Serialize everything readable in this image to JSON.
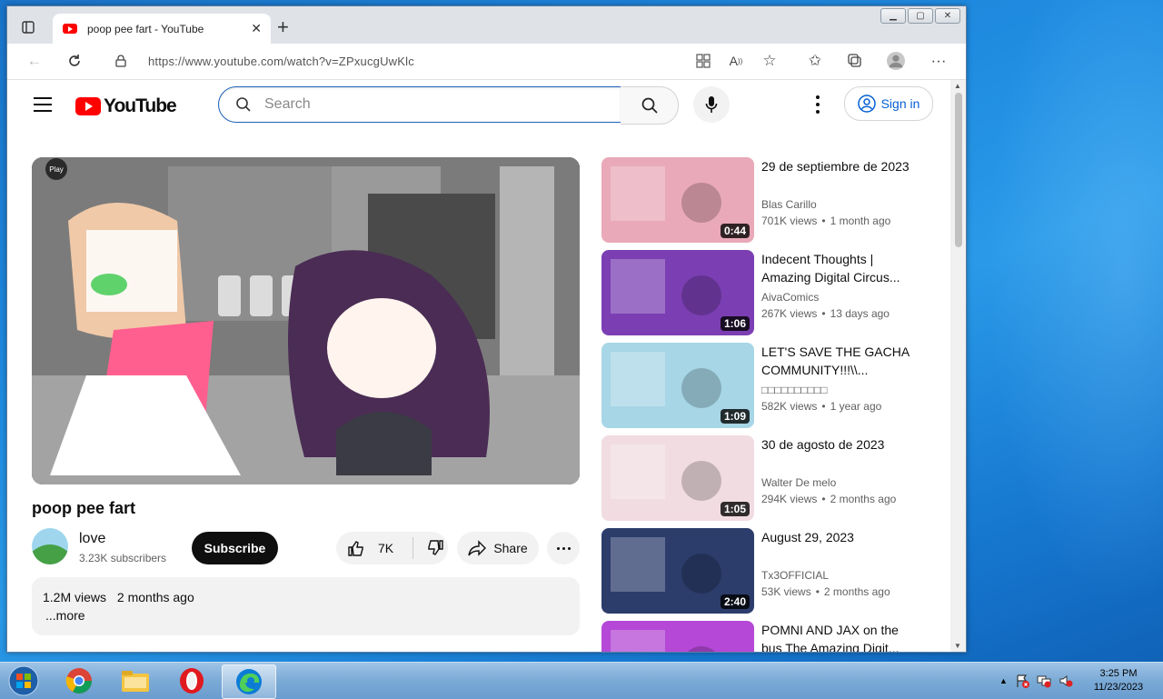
{
  "browser": {
    "tab_title": "poop pee fart - YouTube",
    "url": "https://www.youtube.com/watch?v=ZPxucgUwKlc"
  },
  "youtube": {
    "logo_text": "YouTube",
    "search_placeholder": "Search",
    "sign_in_label": "Sign in",
    "video_title": "poop pee fart",
    "channel_name": "love",
    "subscribers": "3.23K subscribers",
    "subscribe_label": "Subscribe",
    "like_count": "7K",
    "share_label": "Share",
    "views": "1.2M views",
    "upload_date": "2 months ago",
    "more_label": "...more",
    "player_badge": "Play"
  },
  "recommendations": [
    {
      "title": "29 de septiembre de 2023",
      "channel": "Blas Carillo",
      "views": "701K views",
      "age": "1 month ago",
      "duration": "0:44",
      "thumb_color": "#e9a9b8"
    },
    {
      "title": "Indecent Thoughts | Amazing Digital Circus...",
      "channel": "AivaComics",
      "views": "267K views",
      "age": "13 days ago",
      "duration": "1:06",
      "thumb_color": "#7b3fb3"
    },
    {
      "title": "LET'S SAVE THE GACHA COMMUNITY!!!\\\\...",
      "channel": "□□□□□□□□□□",
      "views": "582K views",
      "age": "1 year ago",
      "duration": "1:09",
      "thumb_color": "#a7d6e6"
    },
    {
      "title": "30 de agosto de 2023",
      "channel": "Walter De melo",
      "views": "294K views",
      "age": "2 months ago",
      "duration": "1:05",
      "thumb_color": "#f1dce1"
    },
    {
      "title": "August 29, 2023",
      "channel": "Tx3OFFICIAL",
      "views": "53K views",
      "age": "2 months ago",
      "duration": "2:40",
      "thumb_color": "#2c3d6b"
    },
    {
      "title": "POMNI AND JAX on the bus The Amazing Digit...",
      "channel": "",
      "views": "",
      "age": "",
      "duration": "",
      "thumb_color": "#b548d6"
    }
  ],
  "taskbar": {
    "apps": [
      "chrome-icon",
      "file-explorer-icon",
      "opera-icon",
      "edge-icon"
    ],
    "time": "3:25 PM",
    "date": "11/23/2023"
  }
}
